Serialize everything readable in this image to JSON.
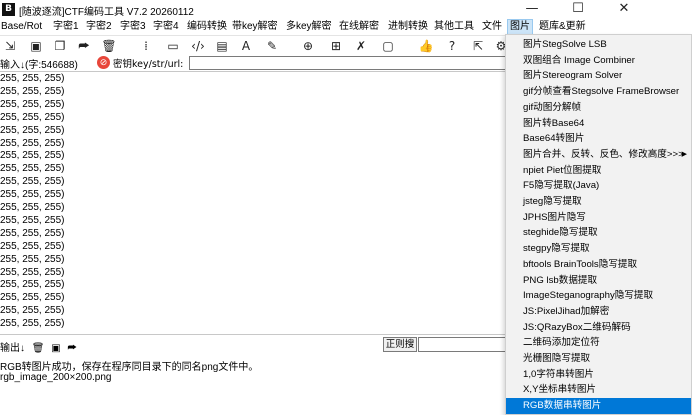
{
  "window": {
    "icon_text": "B",
    "title": "[随波逐流]CTF编码工具 V7.2  20260112",
    "controls": [
      "—",
      "☐",
      "✕"
    ]
  },
  "menubar": {
    "items": [
      "Base/Rot",
      "字密1",
      "字密2",
      "字密3",
      "字密4",
      "编码转换",
      "带key解密",
      "多key解密",
      "在线解密",
      "进制转换",
      "其他工具",
      "文件",
      "图片",
      "题库&更新"
    ],
    "active": "图片"
  },
  "input_bar": {
    "label": "输入↓(字:546688)",
    "key_label": "密钥key/str/url:",
    "key_value": ""
  },
  "input_lines": [
    "255, 255, 255)",
    "255, 255, 255)",
    "255, 255, 255)",
    "255, 255, 255)",
    "255, 255, 255)",
    "255, 255, 255)",
    "255, 255, 255)",
    "255, 255, 255)",
    "255, 255, 255)",
    "255, 255, 255)",
    "255, 255, 255)",
    "255, 255, 255)",
    "255, 255, 255)",
    "255, 255, 255)",
    "255, 255, 255)",
    "255, 255, 255)",
    "255, 255, 255)",
    "255, 255, 255)",
    "255, 255, 255)",
    "255, 255, 255)"
  ],
  "output_bar": {
    "label": "输出↓",
    "regex_button": "正则搜"
  },
  "output_lines": [
    "RGB转图片成功，保存在程序同目录下的同名png文件中。",
    "rgb_image_200×200.png"
  ],
  "dropdown": {
    "items": [
      "图片StegSolve LSB",
      "双图组合 Image Combiner",
      "图片Stereogram Solver",
      "gif分帧查看Stegsolve FrameBrowser",
      "gif动图分解帧",
      "图片转Base64",
      "Base64转图片",
      "图片合并、反转、反色、修改高度>>>",
      "npiet Piet位图提取",
      "F5隐写提取(Java)",
      "jsteg隐写提取",
      "JPHS图片隐写",
      "steghide隐写提取",
      "stegpy隐写提取",
      "bftools BrainTools隐写提取",
      "PNG lsb数据提取",
      "ImageSteganography隐写提取",
      "JS:PixelJihad加解密",
      "JS:QRazyBox二维码解码",
      "二维码添加定位符",
      "光栅图隐写提取",
      "1,0字符串转图片",
      "X,Y坐标串转图片",
      "RGB数据串转图片"
    ],
    "highlighted_index": 23,
    "submenu_index": 7
  },
  "colors": {
    "highlight": "#0078d7",
    "key_icon": "#e8463a"
  }
}
